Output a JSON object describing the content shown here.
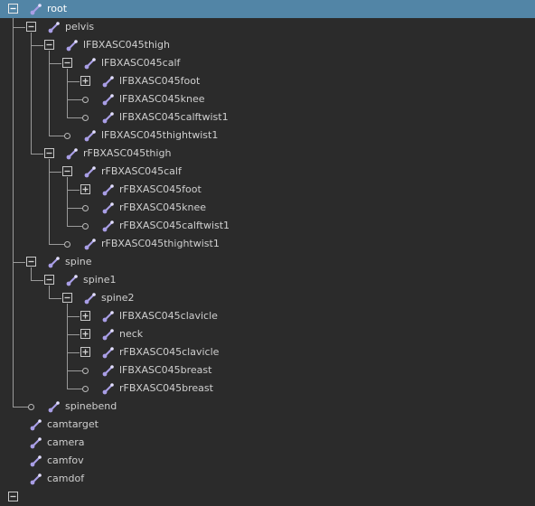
{
  "outliner": {
    "nodes": [
      {
        "label": "root",
        "depth": 0,
        "toggle": "expanded",
        "selected": true
      },
      {
        "label": "pelvis",
        "depth": 1,
        "toggle": "expanded"
      },
      {
        "label": "lFBXASC045thigh",
        "depth": 2,
        "toggle": "expanded"
      },
      {
        "label": "lFBXASC045calf",
        "depth": 3,
        "toggle": "expanded"
      },
      {
        "label": "lFBXASC045foot",
        "depth": 4,
        "toggle": "collapsed"
      },
      {
        "label": "lFBXASC045knee",
        "depth": 4,
        "toggle": "leaf"
      },
      {
        "label": "lFBXASC045calftwist1",
        "depth": 4,
        "toggle": "leaf"
      },
      {
        "label": "lFBXASC045thightwist1",
        "depth": 3,
        "toggle": "leaf"
      },
      {
        "label": "rFBXASC045thigh",
        "depth": 2,
        "toggle": "expanded"
      },
      {
        "label": "rFBXASC045calf",
        "depth": 3,
        "toggle": "expanded"
      },
      {
        "label": "rFBXASC045foot",
        "depth": 4,
        "toggle": "collapsed"
      },
      {
        "label": "rFBXASC045knee",
        "depth": 4,
        "toggle": "leaf"
      },
      {
        "label": "rFBXASC045calftwist1",
        "depth": 4,
        "toggle": "leaf"
      },
      {
        "label": "rFBXASC045thightwist1",
        "depth": 3,
        "toggle": "leaf"
      },
      {
        "label": "spine",
        "depth": 1,
        "toggle": "expanded"
      },
      {
        "label": "spine1",
        "depth": 2,
        "toggle": "expanded"
      },
      {
        "label": "spine2",
        "depth": 3,
        "toggle": "expanded"
      },
      {
        "label": "lFBXASC045clavicle",
        "depth": 4,
        "toggle": "collapsed"
      },
      {
        "label": "neck",
        "depth": 4,
        "toggle": "collapsed"
      },
      {
        "label": "rFBXASC045clavicle",
        "depth": 4,
        "toggle": "collapsed"
      },
      {
        "label": "lFBXASC045breast",
        "depth": 4,
        "toggle": "leaf"
      },
      {
        "label": "rFBXASC045breast",
        "depth": 4,
        "toggle": "leaf"
      },
      {
        "label": "spinebend",
        "depth": 1,
        "toggle": "leaf"
      },
      {
        "label": "camtarget",
        "depth": 0,
        "toggle": "none"
      },
      {
        "label": "camera",
        "depth": 0,
        "toggle": "none"
      },
      {
        "label": "camfov",
        "depth": 0,
        "toggle": "none"
      },
      {
        "label": "camdof",
        "depth": 0,
        "toggle": "none"
      },
      {
        "label": "",
        "depth": 0,
        "toggle": "expanded",
        "partial": true
      }
    ],
    "icon": "joint-icon",
    "colors": {
      "background": "#2b2b2b",
      "selection": "#5285a6",
      "text": "#cfcfcf",
      "joint_icon": "#a99ee6"
    }
  }
}
